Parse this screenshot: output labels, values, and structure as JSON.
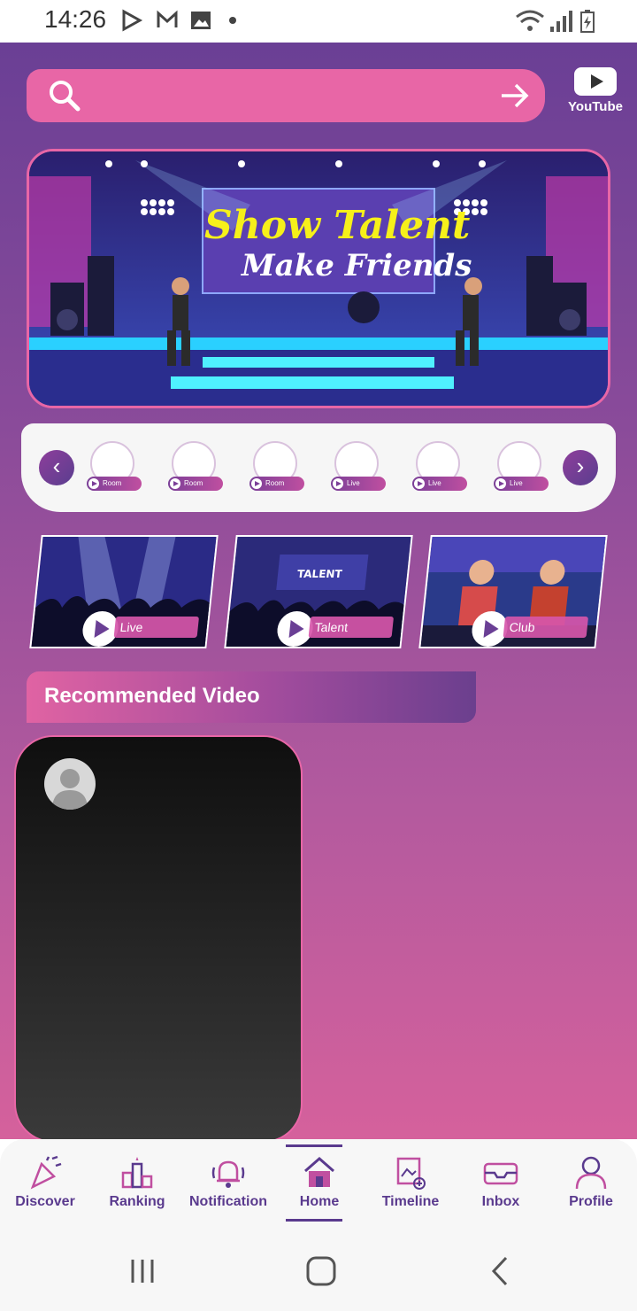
{
  "status_bar": {
    "time": "14:26"
  },
  "search": {
    "placeholder": ""
  },
  "youtube": {
    "label": "YouTube"
  },
  "banner": {
    "line1": "Show Talent",
    "line2": "Make Friends"
  },
  "circle_items": [
    {
      "tag": "Room"
    },
    {
      "tag": "Room"
    },
    {
      "tag": "Room"
    },
    {
      "tag": "Live"
    },
    {
      "tag": "Live"
    },
    {
      "tag": "Live"
    }
  ],
  "categories": [
    {
      "label": "Live",
      "stage_text": ""
    },
    {
      "label": "Talent",
      "stage_text": "TALENT"
    },
    {
      "label": "Club",
      "stage_text": ""
    }
  ],
  "recommended": {
    "title": "Recommended Video"
  },
  "nav": [
    {
      "label": "Discover",
      "icon": "party-popper-icon"
    },
    {
      "label": "Ranking",
      "icon": "ranking-podium-icon"
    },
    {
      "label": "Notification",
      "icon": "bell-icon"
    },
    {
      "label": "Home",
      "icon": "home-icon",
      "active": true
    },
    {
      "label": "Timeline",
      "icon": "timeline-image-icon"
    },
    {
      "label": "Inbox",
      "icon": "inbox-tray-icon"
    },
    {
      "label": "Profile",
      "icon": "person-icon"
    }
  ],
  "colors": {
    "accent": "#e866a6",
    "nav_text": "#5a3a8e"
  }
}
